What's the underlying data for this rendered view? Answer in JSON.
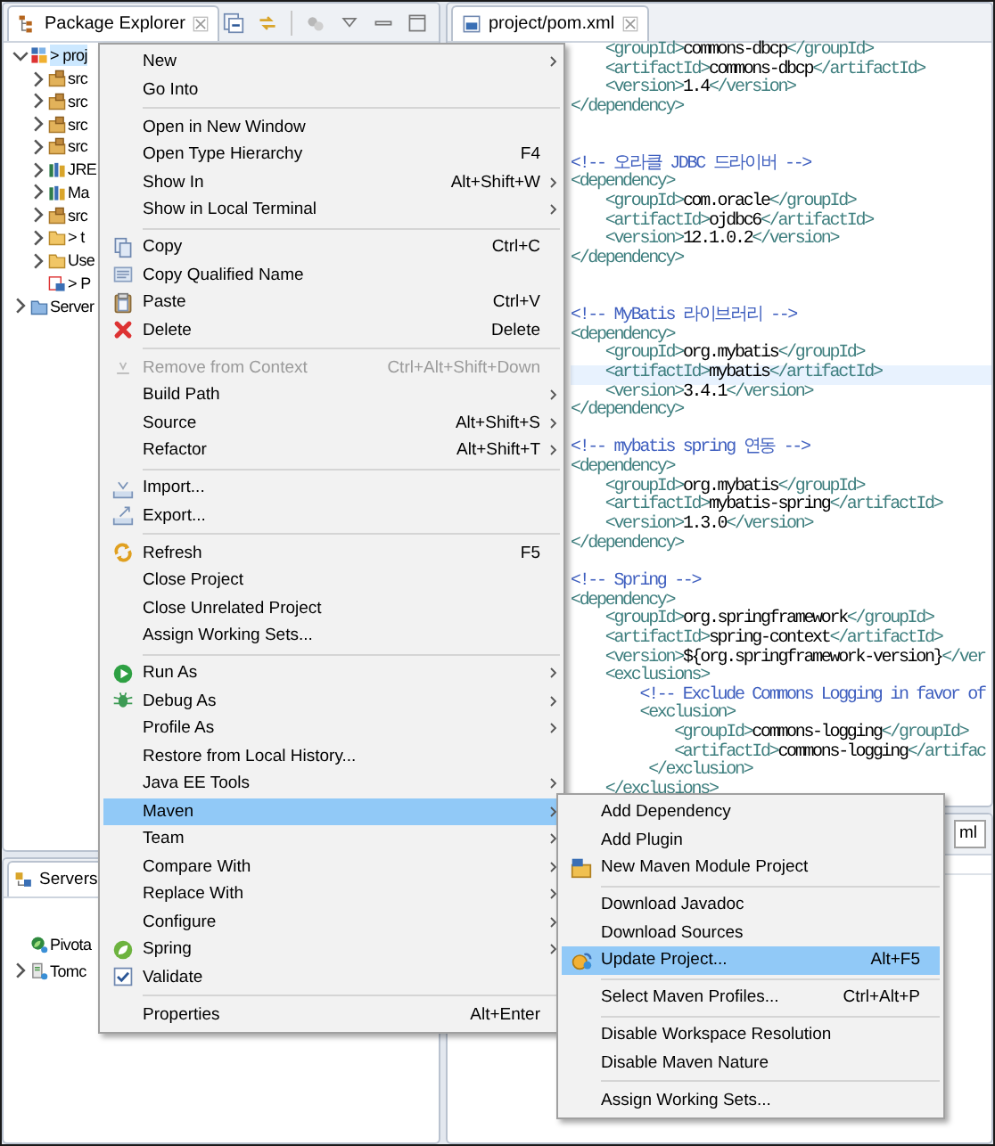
{
  "explorer": {
    "tab": {
      "label": "Package Explorer"
    },
    "items": [
      {
        "label": "> proj",
        "kind": "project",
        "leaf": false,
        "expanded": true,
        "selected": true,
        "children": [
          {
            "label": "src",
            "kind": "source-folder",
            "leaf": false,
            "expanded": false,
            "selected": false
          },
          {
            "label": "src",
            "kind": "source-folder",
            "leaf": false,
            "expanded": false,
            "selected": false
          },
          {
            "label": "src",
            "kind": "source-folder",
            "leaf": false,
            "expanded": false,
            "selected": false
          },
          {
            "label": "src",
            "kind": "source-folder",
            "leaf": false,
            "expanded": false,
            "selected": false
          },
          {
            "label": "JRE",
            "kind": "library",
            "leaf": false,
            "expanded": false,
            "selected": false
          },
          {
            "label": "Ma",
            "kind": "library",
            "leaf": false,
            "expanded": false,
            "selected": false
          },
          {
            "label": "src",
            "kind": "source-folder",
            "leaf": false,
            "expanded": false,
            "selected": false
          },
          {
            "label": "> t",
            "kind": "folder",
            "leaf": false,
            "expanded": false,
            "selected": false
          },
          {
            "label": "Use",
            "kind": "folder",
            "leaf": false,
            "expanded": false,
            "selected": false
          },
          {
            "label": "> P",
            "kind": "project-file",
            "leaf": true,
            "selected": false
          }
        ]
      },
      {
        "label": "Server",
        "kind": "server-folder",
        "leaf": false,
        "expanded": false,
        "selected": false
      }
    ]
  },
  "servers": {
    "tab": {
      "label": "Servers"
    },
    "items": [
      {
        "label": "Pivota",
        "kind": "spring-server",
        "leaf": true,
        "selected": false
      },
      {
        "label": "Tomc",
        "kind": "server",
        "leaf": false,
        "expanded": false,
        "selected": false
      }
    ]
  },
  "editor": {
    "tab": {
      "label": "project/pom.xml"
    },
    "lines": [
      {
        "current": false,
        "tokens": [
          {
            "kind": "tag",
            "text": "    <groupId>"
          },
          {
            "kind": "text",
            "text": "commons-dbcp"
          },
          {
            "kind": "tag",
            "text": "</groupId>"
          }
        ]
      },
      {
        "current": false,
        "tokens": [
          {
            "kind": "tag",
            "text": "    <artifactId>"
          },
          {
            "kind": "text",
            "text": "commons-dbcp"
          },
          {
            "kind": "tag",
            "text": "</artifactId>"
          }
        ]
      },
      {
        "current": false,
        "tokens": [
          {
            "kind": "tag",
            "text": "    <version>"
          },
          {
            "kind": "text",
            "text": "1.4"
          },
          {
            "kind": "tag",
            "text": "</version>"
          }
        ]
      },
      {
        "current": false,
        "tokens": [
          {
            "kind": "tag",
            "text": "</dependency>"
          }
        ]
      },
      {
        "current": false
      },
      {
        "current": false
      },
      {
        "current": false,
        "tokens": [
          {
            "kind": "comment",
            "text": "<!-- 오라클 JDBC 드라이버 -->"
          }
        ]
      },
      {
        "current": false,
        "tokens": [
          {
            "kind": "tag",
            "text": "<dependency>"
          }
        ]
      },
      {
        "current": false,
        "tokens": [
          {
            "kind": "tag",
            "text": "    <groupId>"
          },
          {
            "kind": "text",
            "text": "com.oracle"
          },
          {
            "kind": "tag",
            "text": "</groupId>"
          }
        ]
      },
      {
        "current": false,
        "tokens": [
          {
            "kind": "tag",
            "text": "    <artifactId>"
          },
          {
            "kind": "text",
            "text": "ojdbc6"
          },
          {
            "kind": "tag",
            "text": "</artifactId>"
          }
        ]
      },
      {
        "current": false,
        "tokens": [
          {
            "kind": "tag",
            "text": "    <version>"
          },
          {
            "kind": "text",
            "text": "12.1.0.2"
          },
          {
            "kind": "tag",
            "text": "</version>"
          }
        ]
      },
      {
        "current": false,
        "tokens": [
          {
            "kind": "tag",
            "text": "</dependency>"
          }
        ]
      },
      {
        "current": false
      },
      {
        "current": false
      },
      {
        "current": false,
        "tokens": [
          {
            "kind": "comment",
            "text": "<!-- MyBatis 라이브러리 -->"
          }
        ]
      },
      {
        "current": false,
        "tokens": [
          {
            "kind": "tag",
            "text": "<dependency>"
          }
        ]
      },
      {
        "current": false,
        "tokens": [
          {
            "kind": "tag",
            "text": "    <groupId>"
          },
          {
            "kind": "text",
            "text": "org.mybatis"
          },
          {
            "kind": "tag",
            "text": "</groupId>"
          }
        ]
      },
      {
        "current": true,
        "tokens": [
          {
            "kind": "tag",
            "text": "    <artifactId>"
          },
          {
            "kind": "text",
            "text": "mybatis"
          },
          {
            "kind": "tag",
            "text": "</artifactId>"
          }
        ]
      },
      {
        "current": false,
        "tokens": [
          {
            "kind": "tag",
            "text": "    <version>"
          },
          {
            "kind": "text",
            "text": "3.4.1"
          },
          {
            "kind": "tag",
            "text": "</version>"
          }
        ]
      },
      {
        "current": false,
        "tokens": [
          {
            "kind": "tag",
            "text": "</dependency>"
          }
        ]
      },
      {
        "current": false
      },
      {
        "current": false,
        "tokens": [
          {
            "kind": "comment",
            "text": "<!-- mybatis spring 연동 -->"
          }
        ]
      },
      {
        "current": false,
        "tokens": [
          {
            "kind": "tag",
            "text": "<dependency>"
          }
        ]
      },
      {
        "current": false,
        "tokens": [
          {
            "kind": "tag",
            "text": "    <groupId>"
          },
          {
            "kind": "text",
            "text": "org.mybatis"
          },
          {
            "kind": "tag",
            "text": "</groupId>"
          }
        ]
      },
      {
        "current": false,
        "tokens": [
          {
            "kind": "tag",
            "text": "    <artifactId>"
          },
          {
            "kind": "text",
            "text": "mybatis-spring"
          },
          {
            "kind": "tag",
            "text": "</artifactId>"
          }
        ]
      },
      {
        "current": false,
        "tokens": [
          {
            "kind": "tag",
            "text": "    <version>"
          },
          {
            "kind": "text",
            "text": "1.3.0"
          },
          {
            "kind": "tag",
            "text": "</version>"
          }
        ]
      },
      {
        "current": false,
        "tokens": [
          {
            "kind": "tag",
            "text": "</dependency>"
          }
        ]
      },
      {
        "current": false
      },
      {
        "current": false,
        "tokens": [
          {
            "kind": "comment",
            "text": "<!-- Spring -->"
          }
        ]
      },
      {
        "current": false,
        "tokens": [
          {
            "kind": "tag",
            "text": "<dependency>"
          }
        ]
      },
      {
        "current": false,
        "tokens": [
          {
            "kind": "tag",
            "text": "    <groupId>"
          },
          {
            "kind": "text",
            "text": "org.springframework"
          },
          {
            "kind": "tag",
            "text": "</groupId>"
          }
        ]
      },
      {
        "current": false,
        "tokens": [
          {
            "kind": "tag",
            "text": "    <artifactId>"
          },
          {
            "kind": "text",
            "text": "spring-context"
          },
          {
            "kind": "tag",
            "text": "</artifactId>"
          }
        ]
      },
      {
        "current": false,
        "tokens": [
          {
            "kind": "tag",
            "text": "    <version>"
          },
          {
            "kind": "text",
            "text": "${org.springframework-version}"
          },
          {
            "kind": "tag",
            "text": "</ver"
          }
        ]
      },
      {
        "current": false,
        "tokens": [
          {
            "kind": "tag",
            "text": "    <exclusions>"
          }
        ]
      },
      {
        "current": false,
        "tokens": [
          {
            "kind": "comment",
            "text": "        <!-- Exclude Commons Logging in favor of"
          }
        ]
      },
      {
        "current": false,
        "tokens": [
          {
            "kind": "tag",
            "text": "        <exclusion>"
          }
        ]
      },
      {
        "current": false,
        "tokens": [
          {
            "kind": "tag",
            "text": "            <groupId>"
          },
          {
            "kind": "text",
            "text": "commons-logging"
          },
          {
            "kind": "tag",
            "text": "</groupId>"
          }
        ]
      },
      {
        "current": false,
        "tokens": [
          {
            "kind": "tag",
            "text": "            <artifactId>"
          },
          {
            "kind": "text",
            "text": "commons-logging"
          },
          {
            "kind": "tag",
            "text": "</artifac"
          }
        ]
      },
      {
        "current": false,
        "tokens": [
          {
            "kind": "tag",
            "text": "         </exclusion>"
          }
        ]
      },
      {
        "current": false,
        "tokens": [
          {
            "kind": "tag",
            "text": "    </exclusions>"
          }
        ]
      }
    ]
  },
  "bottom_panel": {
    "field": {
      "value": "ml"
    }
  },
  "menu": {
    "groups": [
      {
        "items": [
          {
            "label": "New",
            "submenu": true,
            "disabled": false,
            "selected": false
          },
          {
            "label": "Go Into",
            "submenu": false,
            "disabled": false,
            "selected": false
          }
        ]
      },
      {
        "items": [
          {
            "label": "Open in New Window",
            "submenu": false,
            "disabled": false,
            "selected": false
          },
          {
            "label": "Open Type Hierarchy",
            "shortcut": "F4",
            "submenu": false,
            "disabled": false,
            "selected": false
          },
          {
            "label": "Show In",
            "shortcut": "Alt+Shift+W",
            "submenu": true,
            "disabled": false,
            "selected": false
          },
          {
            "label": "Show in Local Terminal",
            "submenu": true,
            "disabled": false,
            "selected": false
          }
        ]
      },
      {
        "items": [
          {
            "label": "Copy",
            "shortcut": "Ctrl+C",
            "kind": "copy",
            "submenu": false,
            "disabled": false,
            "selected": false
          },
          {
            "label": "Copy Qualified Name",
            "kind": "copy-name",
            "submenu": false,
            "disabled": false,
            "selected": false
          },
          {
            "label": "Paste",
            "shortcut": "Ctrl+V",
            "kind": "paste",
            "submenu": false,
            "disabled": false,
            "selected": false
          },
          {
            "label": "Delete",
            "shortcut": "Delete",
            "kind": "delete",
            "submenu": false,
            "disabled": false,
            "selected": false
          }
        ]
      },
      {
        "items": [
          {
            "label": "Remove from Context",
            "shortcut": "Ctrl+Alt+Shift+Down",
            "kind": "remove-context",
            "submenu": false,
            "disabled": true,
            "selected": false
          },
          {
            "label": "Build Path",
            "submenu": true,
            "disabled": false,
            "selected": false
          },
          {
            "label": "Source",
            "shortcut": "Alt+Shift+S",
            "submenu": true,
            "disabled": false,
            "selected": false
          },
          {
            "label": "Refactor",
            "shortcut": "Alt+Shift+T",
            "submenu": true,
            "disabled": false,
            "selected": false
          }
        ]
      },
      {
        "items": [
          {
            "label": "Import...",
            "kind": "import",
            "submenu": false,
            "disabled": false,
            "selected": false
          },
          {
            "label": "Export...",
            "kind": "export",
            "submenu": false,
            "disabled": false,
            "selected": false
          }
        ]
      },
      {
        "items": [
          {
            "label": "Refresh",
            "shortcut": "F5",
            "kind": "refresh",
            "submenu": false,
            "disabled": false,
            "selected": false
          },
          {
            "label": "Close Project",
            "submenu": false,
            "disabled": false,
            "selected": false
          },
          {
            "label": "Close Unrelated Project",
            "submenu": false,
            "disabled": false,
            "selected": false
          },
          {
            "label": "Assign Working Sets...",
            "submenu": false,
            "disabled": false,
            "selected": false
          }
        ]
      },
      {
        "items": [
          {
            "label": "Run As",
            "kind": "run",
            "submenu": true,
            "disabled": false,
            "selected": false
          },
          {
            "label": "Debug As",
            "kind": "debug",
            "submenu": true,
            "disabled": false,
            "selected": false
          },
          {
            "label": "Profile As",
            "submenu": true,
            "disabled": false,
            "selected": false
          },
          {
            "label": "Restore from Local History...",
            "submenu": false,
            "disabled": false,
            "selected": false
          },
          {
            "label": "Java EE Tools",
            "submenu": true,
            "disabled": false,
            "selected": false
          },
          {
            "label": "Maven",
            "submenu": true,
            "disabled": false,
            "selected": true
          },
          {
            "label": "Team",
            "submenu": true,
            "disabled": false,
            "selected": false
          },
          {
            "label": "Compare With",
            "submenu": true,
            "disabled": false,
            "selected": false
          },
          {
            "label": "Replace With",
            "submenu": true,
            "disabled": false,
            "selected": false
          },
          {
            "label": "Configure",
            "submenu": true,
            "disabled": false,
            "selected": false
          },
          {
            "label": "Spring",
            "kind": "spring",
            "submenu": true,
            "disabled": false,
            "selected": false
          },
          {
            "label": "Validate",
            "kind": "checkbox",
            "checked": true,
            "submenu": false,
            "disabled": false,
            "selected": false
          }
        ]
      },
      {
        "items": [
          {
            "label": "Properties",
            "shortcut": "Alt+Enter",
            "submenu": false,
            "disabled": false,
            "selected": false
          }
        ]
      }
    ]
  },
  "submenu": {
    "groups": [
      {
        "items": [
          {
            "label": "Add Dependency",
            "submenu": false,
            "disabled": false,
            "selected": false
          },
          {
            "label": "Add Plugin",
            "submenu": false,
            "disabled": false,
            "selected": false
          },
          {
            "label": "New Maven Module Project",
            "kind": "maven-module",
            "submenu": false,
            "disabled": false,
            "selected": false
          }
        ]
      },
      {
        "items": [
          {
            "label": "Download Javadoc",
            "submenu": false,
            "disabled": false,
            "selected": false
          },
          {
            "label": "Download Sources",
            "submenu": false,
            "disabled": false,
            "selected": false
          },
          {
            "label": "Update Project...",
            "shortcut": "Alt+F5",
            "kind": "update",
            "submenu": false,
            "disabled": false,
            "selected": true
          }
        ]
      },
      {
        "items": [
          {
            "label": "Select Maven Profiles...",
            "shortcut": "Ctrl+Alt+P",
            "submenu": false,
            "disabled": false,
            "selected": false
          }
        ]
      },
      {
        "items": [
          {
            "label": "Disable Workspace Resolution",
            "submenu": false,
            "disabled": false,
            "selected": false
          },
          {
            "label": "Disable Maven Nature",
            "submenu": false,
            "disabled": false,
            "selected": false
          }
        ]
      },
      {
        "items": [
          {
            "label": "Assign Working Sets...",
            "submenu": false,
            "disabled": false,
            "selected": false
          }
        ]
      }
    ]
  }
}
